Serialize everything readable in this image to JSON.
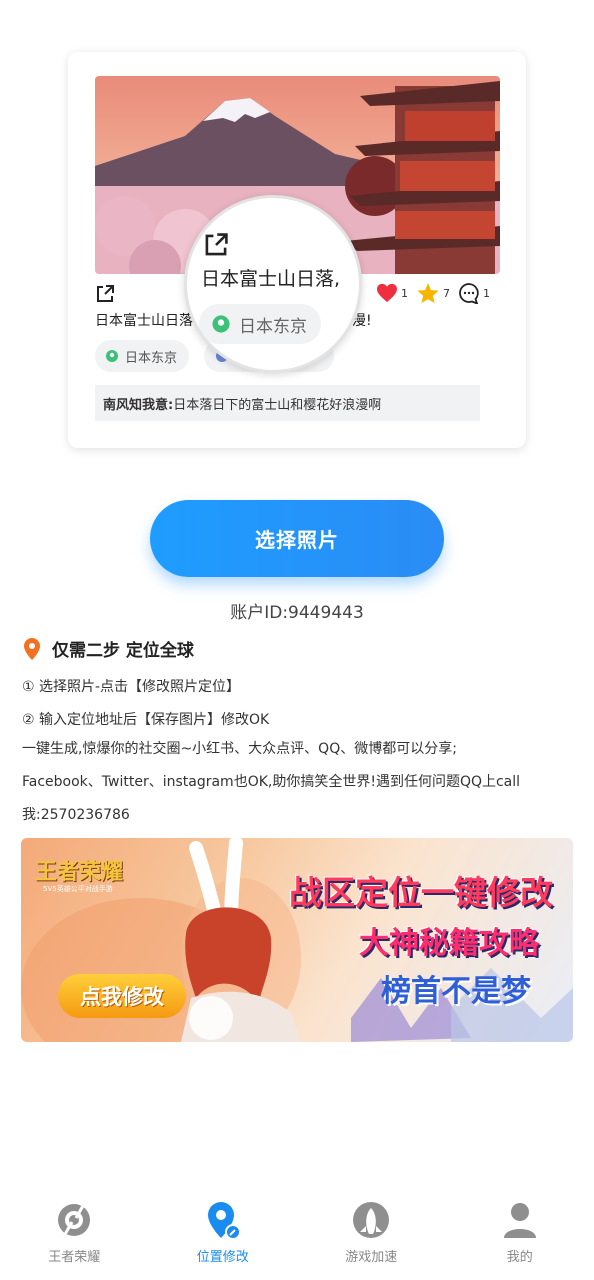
{
  "preview": {
    "post_text": "日本富士山日落",
    "post_text_tail": "浪漫!",
    "likes": "1",
    "stars": "7",
    "comments": "1",
    "location": "日本东京",
    "comment_user": "南风知我意:",
    "comment_text": "日本落日下的富士山和樱花好浪漫啊",
    "magnifier_text": "日本富士山日落,",
    "magnifier_location": "日本东京"
  },
  "select_button": "选择照片",
  "account": "账户ID:9449443",
  "guide": {
    "title": "仅需二步 定位全球",
    "step1": "① 选择照片-点击【修改照片定位】",
    "step2": "② 输入定位地址后【保存图片】修改OK",
    "desc_line1": " 一键生成,惊爆你的社交圈~小红书、大众点评、QQ、微博都可以分享;",
    "desc_line2": "Facebook、Twitter、instagram也OK,助你搞笑全世界!遇到任何问题QQ上call",
    "desc_line3": "我:2570236786"
  },
  "banner": {
    "logo": "王者荣耀",
    "logo_sub": "5V5英雄公平对战手游",
    "line1": "战区定位一键修改",
    "line2": "大神秘籍攻略",
    "line3": "榜首不是梦",
    "button": "点我修改"
  },
  "tabs": [
    {
      "label": "王者荣耀",
      "icon": "game-target-icon"
    },
    {
      "label": "位置修改",
      "icon": "location-edit-icon"
    },
    {
      "label": "游戏加速",
      "icon": "rocket-icon"
    },
    {
      "label": "我的",
      "icon": "user-icon"
    }
  ],
  "colors": {
    "accent": "#1a8cf0",
    "location_pin": "#f36f21",
    "chip_pin": "#3cc17a",
    "like": "#ef2f3f",
    "star": "#f7b500"
  }
}
